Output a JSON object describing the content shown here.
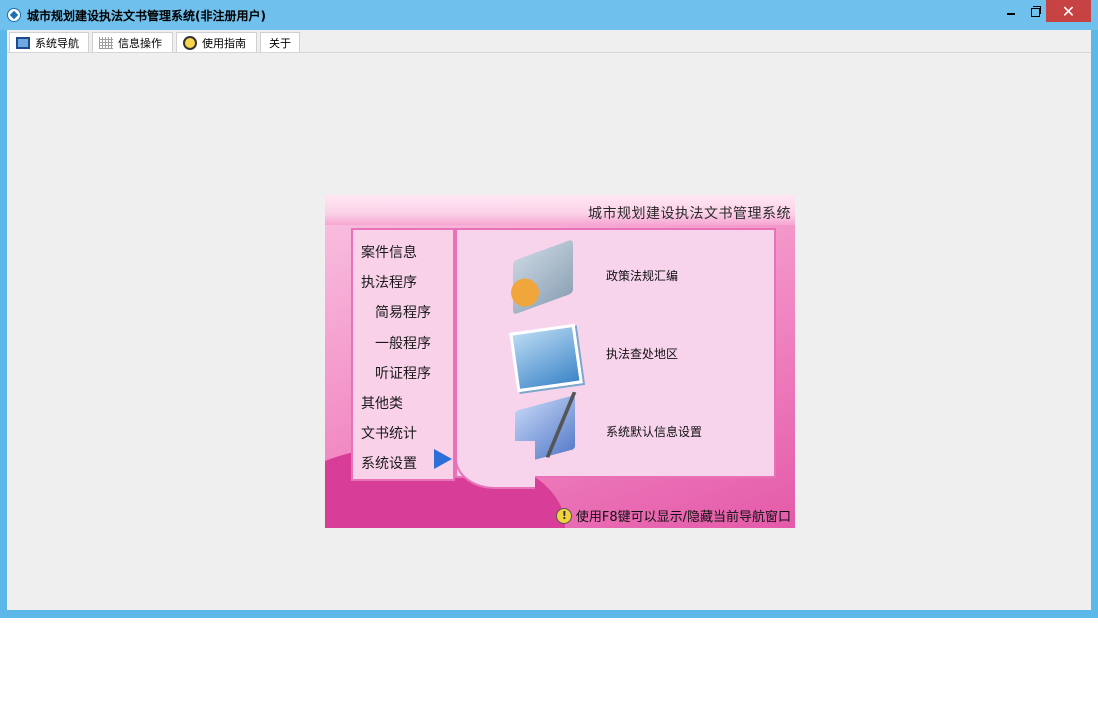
{
  "window": {
    "title": "城市规划建设执法文书管理系统(非注册用户)",
    "close_glyph": "✕"
  },
  "tabs": [
    {
      "label": "系统导航",
      "icon": "nav-icon"
    },
    {
      "label": "信息操作",
      "icon": "grid-icon"
    },
    {
      "label": "使用指南",
      "icon": "guide-icon"
    },
    {
      "label": "关于"
    }
  ],
  "panel": {
    "title": "城市规划建设执法文书管理系统",
    "nav_items": [
      "案件信息",
      "执法程序",
      "简易程序",
      "一般程序",
      "听证程序",
      "其他类",
      "文书统计",
      "系统设置"
    ],
    "content_items": [
      {
        "label": "政策法规汇编",
        "icon": "folder-icon"
      },
      {
        "label": "执法查处地区",
        "icon": "photos-icon"
      },
      {
        "label": "系统默认信息设置",
        "icon": "design-icon"
      }
    ],
    "hint": "使用F8键可以显示/隐藏当前导航窗口"
  }
}
